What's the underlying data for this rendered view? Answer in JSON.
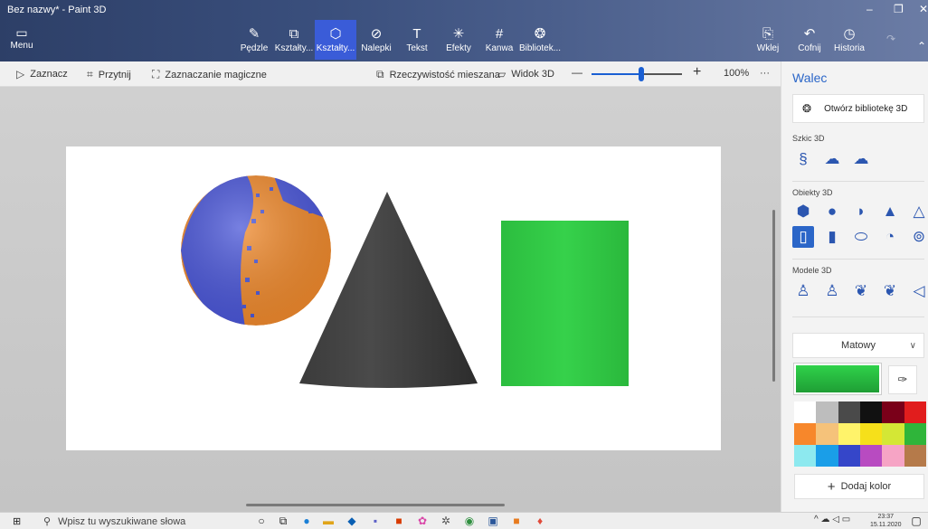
{
  "window": {
    "title": "Bez nazwy* - Paint 3D",
    "minimize_glyph": "–",
    "maximize_glyph": "❐",
    "close_glyph": "✕"
  },
  "ribbon": {
    "menu": {
      "label": "Menu",
      "icon": "folder-icon"
    },
    "tools": [
      {
        "label": "Pędzle",
        "icon": "brush-icon",
        "glyph": "✎",
        "active": false
      },
      {
        "label": "Kształty...",
        "icon": "shapes2d-icon",
        "glyph": "⧉",
        "active": false
      },
      {
        "label": "Kształty...",
        "icon": "shapes3d-icon",
        "glyph": "⬡",
        "active": true
      },
      {
        "label": "Nalepki",
        "icon": "sticker-icon",
        "glyph": "⊘",
        "active": false
      },
      {
        "label": "Tekst",
        "icon": "text-icon",
        "glyph": "T",
        "active": false
      },
      {
        "label": "Efekty",
        "icon": "effects-icon",
        "glyph": "✳",
        "active": false
      },
      {
        "label": "Kanwa",
        "icon": "canvas-icon",
        "glyph": "#",
        "active": false
      },
      {
        "label": "Bibliotek...",
        "icon": "library-icon",
        "glyph": "❂",
        "active": false
      }
    ],
    "right_tools": [
      {
        "label": "Wklej",
        "icon": "paste-icon",
        "glyph": "📋"
      },
      {
        "label": "Cofnij",
        "icon": "undo-icon",
        "glyph": "↶"
      },
      {
        "label": "Historia",
        "icon": "history-icon",
        "glyph": "◷"
      }
    ]
  },
  "subbar": {
    "select": "Zaznacz",
    "crop": "Przytnij",
    "magic_select": "Zaznaczanie magiczne",
    "mixed_reality": "Rzeczywistość mieszana",
    "view3d": "Widok 3D",
    "zoom_minus": "—",
    "zoom_plus": "+",
    "zoom_percent": "100%",
    "zoom_level": 0.55,
    "more": "···"
  },
  "panel": {
    "title": "Walec",
    "open_library": "Otwórz bibliotekę 3D",
    "sketch_label": "Szkic 3D",
    "objects_label": "Obiekty 3D",
    "models_label": "Modele 3D",
    "material": "Matowy",
    "add_color": "Dodaj kolor",
    "selected_color": "#2ecc40",
    "palette": [
      "#ffffff",
      "#bdbdbd",
      "#4a4a4a",
      "#111111",
      "#7a0019",
      "#e11d1d",
      "#f7872b",
      "#f5c27a",
      "#fff36a",
      "#f6e01a",
      "#d4e735",
      "#2fb53a",
      "#8de9ef",
      "#1a9ee8",
      "#3546c9",
      "#b84bc1",
      "#f6a4c5",
      "#b57a4a"
    ]
  },
  "taskbar": {
    "search_placeholder": "Wpisz tu wyszukiwane słowa",
    "time": "23:37",
    "date": "15.11.2020"
  }
}
